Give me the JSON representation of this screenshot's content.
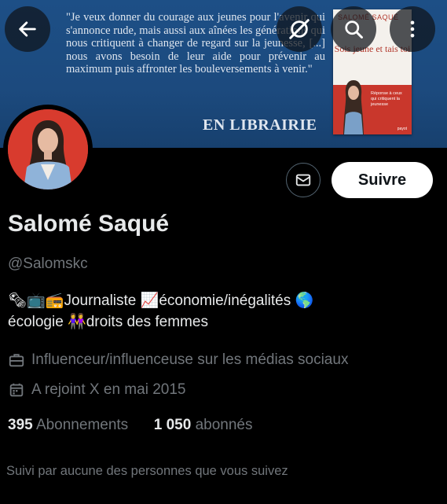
{
  "banner": {
    "quote": "\"Je veux donner du courage aux jeunes pour l'avenir qui s'annonce rude, mais aussi aux aînées les générations qui nous critiquent à changer de regard sur la jeunesse, [...] nous avons besoin de leur aide pour prévenir au maximum puis affronter les bouleversements à venir.\"",
    "tagline": "EN LIBRAIRIE",
    "book": {
      "author": "SALOMÉ SAQUÉ",
      "title": "Sois jeune et tais toi",
      "subtitle": "Réponse à ceux qui critiquent la jeunesse",
      "publisher": "payot"
    }
  },
  "top_buttons": {
    "back_icon": "arrow-left-icon",
    "grok_icon": "grok-icon",
    "search_icon": "search-icon",
    "more_icon": "more-vertical-icon"
  },
  "profile": {
    "name": "Salomé Saqué",
    "handle": "@Salomskc",
    "bio_line1": "Journaliste",
    "bio_segment2": "économie/inégalités",
    "bio_line2_a": "écologie",
    "bio_line2_b": "droits des femmes",
    "emoji": {
      "news": "🗞",
      "tv": "📺",
      "radio": "📻",
      "chart": "📈",
      "globe": "🌎",
      "women": "👭"
    },
    "category": "Influenceur/influenceuse sur les médias sociaux",
    "joined": "A rejoint X en mai 2015",
    "following_count": "395",
    "following_label": "Abonnements",
    "followers_count": "1 050",
    "followers_label": "abonnés",
    "followed_by": "Suivi par aucune des personnes que vous suivez"
  },
  "actions": {
    "message_icon": "envelope-icon",
    "follow_label": "Suivre"
  },
  "colors": {
    "background": "#000000",
    "banner": "#1d4f86",
    "text": "#e7e9ea",
    "secondary_text": "#71767b",
    "avatar_bg": "#d83b2e"
  }
}
